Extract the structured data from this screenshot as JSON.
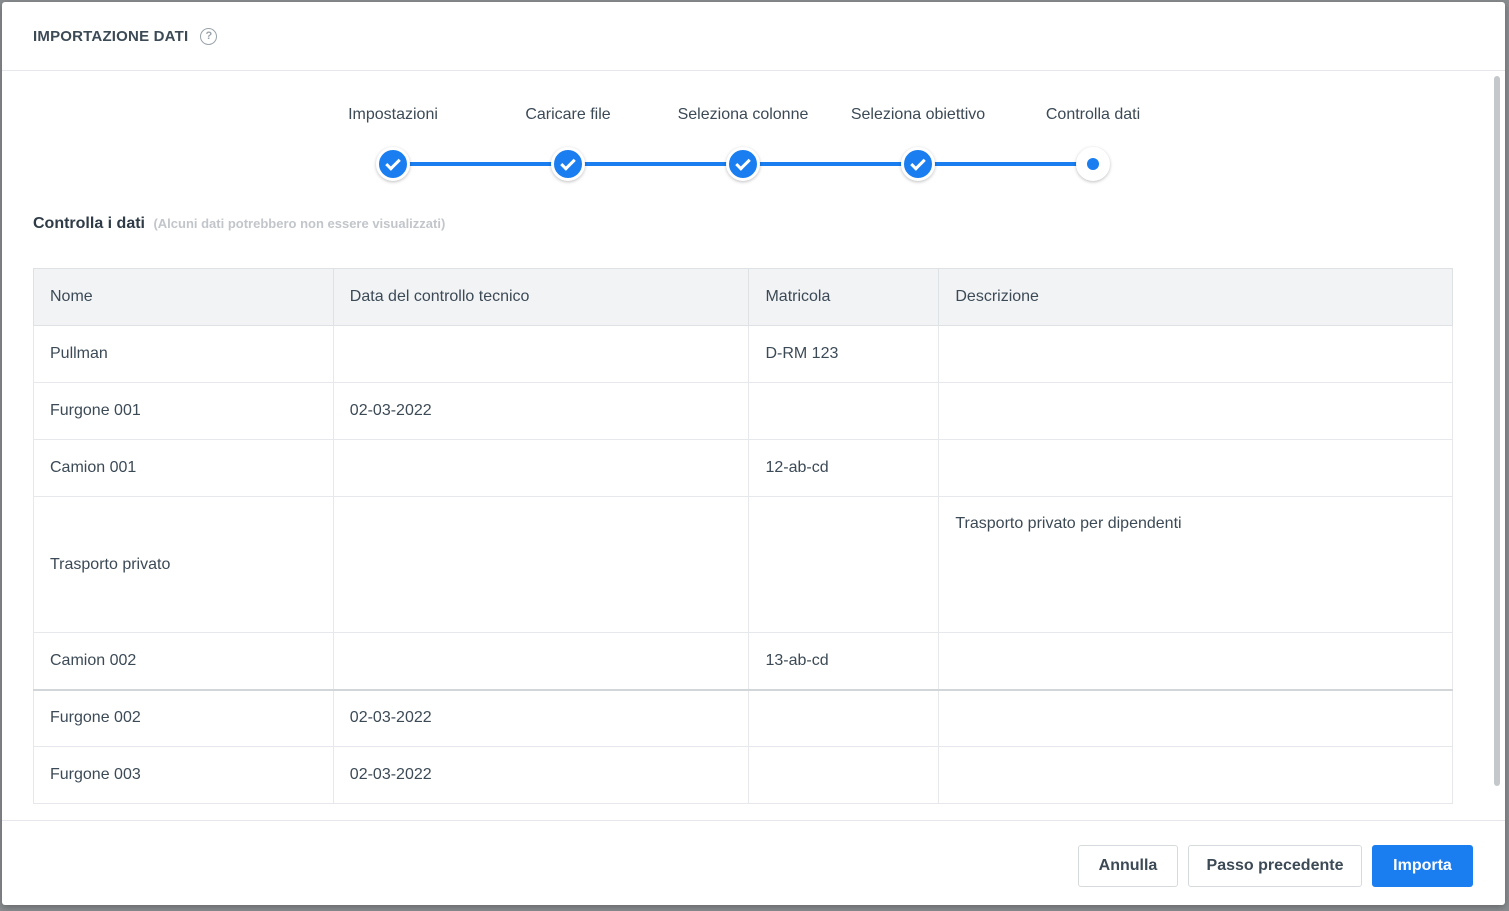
{
  "dialog": {
    "title": "IMPORTAZIONE DATI",
    "help_icon": "question-circle-icon"
  },
  "stepper": {
    "steps": [
      {
        "label": "Impostazioni",
        "state": "done"
      },
      {
        "label": "Caricare file",
        "state": "done"
      },
      {
        "label": "Seleziona colonne",
        "state": "done"
      },
      {
        "label": "Seleziona obiettivo",
        "state": "done"
      },
      {
        "label": "Controlla dati",
        "state": "current"
      }
    ],
    "accent_color": "#1a7ef0"
  },
  "section": {
    "title": "Controlla i dati",
    "note": "(Alcuni dati potrebbero non essere visualizzati)"
  },
  "table": {
    "columns": [
      "Nome",
      "Data del controllo tecnico",
      "Matricola",
      "Descrizione"
    ],
    "rows": [
      [
        "Pullman",
        "",
        "D-RM 123",
        ""
      ],
      [
        "Furgone 001",
        "02-03-2022",
        "",
        ""
      ],
      [
        "Camion 001",
        "",
        "12-ab-cd",
        ""
      ],
      [
        "Trasporto privato",
        "",
        "",
        "Trasporto privato per dipendenti"
      ],
      [
        "Camion 002",
        "",
        "13-ab-cd",
        ""
      ],
      [
        "Furgone 002",
        "02-03-2022",
        "",
        ""
      ],
      [
        "Furgone 003",
        "02-03-2022",
        "",
        ""
      ]
    ]
  },
  "footer": {
    "cancel_label": "Annulla",
    "previous_label": "Passo precedente",
    "import_label": "Importa"
  }
}
